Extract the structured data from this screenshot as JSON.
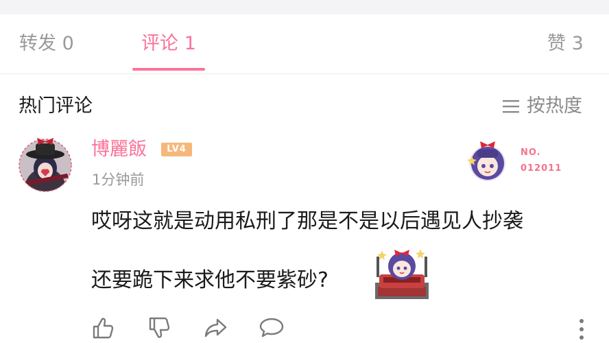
{
  "tabs": [
    {
      "label": "转发 0"
    },
    {
      "label": "评论 1"
    },
    {
      "label": "赞 3"
    }
  ],
  "section": {
    "title": "热门评论",
    "sort_label": "按热度"
  },
  "comment": {
    "username": "博麗飯",
    "level": "LV4",
    "time": "1分钟前",
    "fan_badge": {
      "no_label": "NO.",
      "number": "012011"
    },
    "text_line1": "哎呀这就是动用私刑了那是不是以后遇见人抄袭",
    "text_line2": "还要跪下来求他不要紫砂?"
  },
  "colors": {
    "accent": "#fb7299",
    "muted": "#999999",
    "badge": "#f6b87a"
  },
  "icons": [
    "menu-lines-icon",
    "thumbs-up-icon",
    "thumbs-down-icon",
    "share-icon",
    "reply-icon",
    "more-vertical-icon"
  ]
}
